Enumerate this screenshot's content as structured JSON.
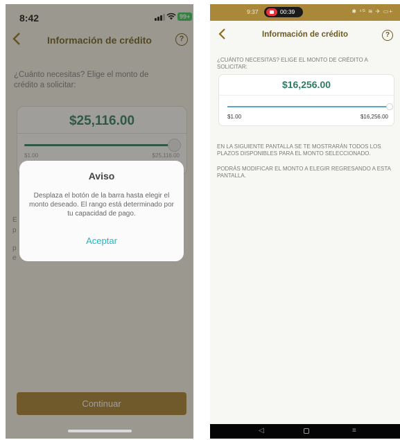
{
  "left_screen": {
    "status_bar": {
      "time": "8:42",
      "battery": "99+",
      "wifi_icon": "wifi-icon",
      "signal_icon": "signal-icon"
    },
    "header": {
      "back_icon": "chevron-left-icon",
      "title": "Información de crédito",
      "help_label": "?"
    },
    "question": "¿Cuánto necesitas? Elige el monto de crédito a solicitar:",
    "amount_card": {
      "amount": "$25,116.00",
      "min_label": "$1.00",
      "max_label": "$25,116.00",
      "slider_fraction": 1.0
    },
    "partial_text": [
      "E",
      "p",
      "p",
      "e"
    ],
    "continue_button": "Continuar",
    "modal": {
      "title": "Aviso",
      "body": "Desplaza el botón de la barra hasta elegir el monto deseado. El rango está determinado por tu capacidad de pago.",
      "accept": "Aceptar"
    },
    "colors": {
      "accent_gold": "#a67c2a",
      "amount_green": "#2b7a5e",
      "link_teal": "#1fb6c8"
    }
  },
  "right_screen": {
    "status_bar": {
      "time": "9:37",
      "recording_time": "00:39",
      "icons_text": "✱ ⁴ᴳ ≋ ✈ ▭+"
    },
    "header": {
      "back_icon": "chevron-left-icon",
      "title": "Información de crédito",
      "help_label": "?"
    },
    "question": "¿CUÁNTO NECESITAS? ELIGE EL MONTO DE CRÉDITO A SOLICITAR:",
    "amount_card": {
      "amount": "$16,256.00",
      "min_label": "$1.00",
      "max_label": "$16,256.00",
      "slider_fraction": 1.0
    },
    "info_1": "EN LA SIGUIENTE PANTALLA SE TE MOSTRARÁN TODOS LOS PLAZOS DISPONIBLES PARA EL MONTO SELECCIONADO.",
    "info_2": "PODRÁS MODIFICAR EL MONTO A ELEGIR REGRESANDO A ESTA PANTALLA.",
    "nav_bar": {
      "back_glyph": "◁",
      "home_icon": "home-square-icon",
      "recents_glyph": "≡"
    },
    "colors": {
      "status_gold": "#a9883a",
      "amount_green": "#2d7b62",
      "slider_blue": "#5aa7c2"
    }
  }
}
